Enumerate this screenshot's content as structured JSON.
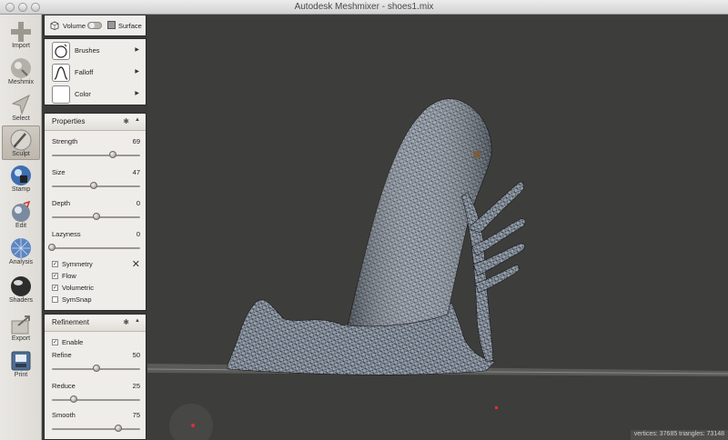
{
  "window": {
    "title": "Autodesk Meshmixer - shoes1.mix"
  },
  "toolbar": [
    {
      "label": "Import",
      "icon": "plus-icon"
    },
    {
      "label": "Meshmix",
      "icon": "meshmix-icon"
    },
    {
      "label": "Select",
      "icon": "select-arrow-icon"
    },
    {
      "label": "Sculpt",
      "icon": "sculpt-brush-icon"
    },
    {
      "label": "Stamp",
      "icon": "stamp-icon"
    },
    {
      "label": "Edit",
      "icon": "edit-icon"
    },
    {
      "label": "Analysis",
      "icon": "analysis-icon"
    },
    {
      "label": "Shaders",
      "icon": "shaders-icon"
    },
    {
      "label": "Export",
      "icon": "export-icon"
    },
    {
      "label": "Print",
      "icon": "print-icon"
    }
  ],
  "mode": {
    "volume_label": "Volume",
    "surface_label": "Surface"
  },
  "brush_panel": {
    "brushes": "Brushes",
    "falloff": "Falloff",
    "color": "Color"
  },
  "properties": {
    "title": "Properties",
    "sliders": [
      {
        "name": "Strength",
        "value": "69",
        "fraction": 0.69
      },
      {
        "name": "Size",
        "value": "47",
        "fraction": 0.47
      },
      {
        "name": "Depth",
        "value": "0",
        "fraction": 0.5
      },
      {
        "name": "Lazyness",
        "value": "0",
        "fraction": 0.0
      }
    ],
    "checks": [
      {
        "label": "Symmetry",
        "checked": true
      },
      {
        "label": "Flow",
        "checked": true
      },
      {
        "label": "Volumetric",
        "checked": true
      },
      {
        "label": "SymSnap",
        "checked": false
      }
    ]
  },
  "refinement": {
    "title": "Refinement",
    "enable_label": "Enable",
    "sliders": [
      {
        "name": "Refine",
        "value": "50",
        "fraction": 0.5
      },
      {
        "name": "Reduce",
        "value": "25",
        "fraction": 0.25
      },
      {
        "name": "Smooth",
        "value": "75",
        "fraction": 0.75
      }
    ]
  },
  "status": {
    "text": "vertices: 37685 triangles: 73148"
  },
  "colors": {
    "viewport_bg": "#3d3d3b",
    "panel_bg": "#efede9",
    "mesh": "#9aa6b4"
  }
}
